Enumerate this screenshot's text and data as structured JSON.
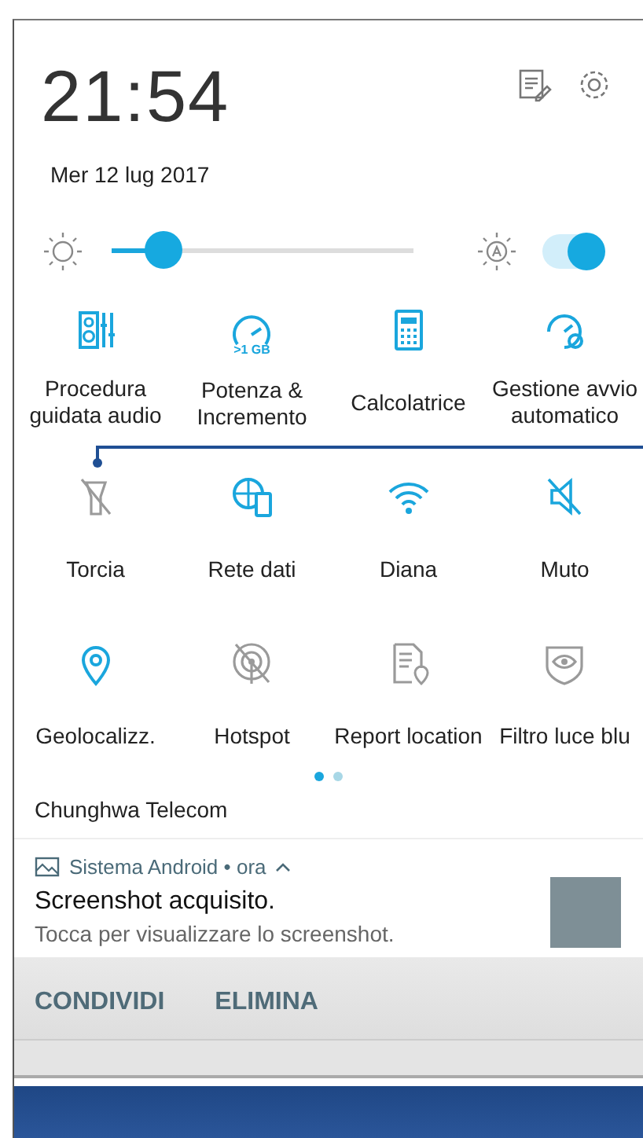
{
  "clock": {
    "time": "21:54",
    "date": "Mer 12 lug 2017"
  },
  "brightness": {
    "level": 0.17,
    "auto": true
  },
  "tiles": [
    {
      "label": "Procedura guidata audio",
      "on": true
    },
    {
      "label": "Potenza & Incremento",
      "on": true,
      "badge": ">1 GB"
    },
    {
      "label": "Calcolatrice",
      "on": true
    },
    {
      "label": "Gestione avvio automatico",
      "on": true
    },
    {
      "label": "Torcia",
      "on": false
    },
    {
      "label": "Rete dati",
      "on": true
    },
    {
      "label": "Diana",
      "on": true
    },
    {
      "label": "Muto",
      "on": true
    },
    {
      "label": "Geolocalizz.",
      "on": true
    },
    {
      "label": "Hotspot",
      "on": false
    },
    {
      "label": "Report location",
      "on": false
    },
    {
      "label": "Filtro luce blu",
      "on": false
    }
  ],
  "pages": [
    {
      "selected": true
    },
    {
      "selected": false
    }
  ],
  "carrier": "Chunghwa Telecom",
  "notification": {
    "app": "Sistema Android",
    "separator": "•",
    "time": "ora",
    "title": "Screenshot acquisito.",
    "text": "Tocca per visualizzare lo screenshot.",
    "actions": [
      "CONDIVIDI",
      "ELIMINA"
    ]
  }
}
